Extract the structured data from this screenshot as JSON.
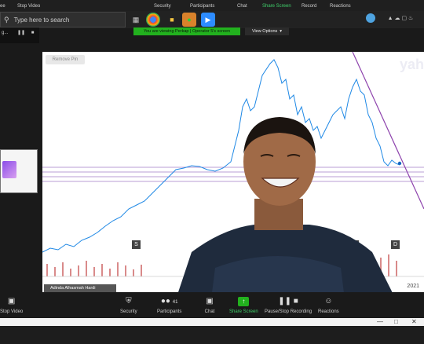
{
  "top_bar": {
    "items": [
      {
        "label": "ee"
      },
      {
        "label": "Stop Video"
      },
      {
        "label": "Security"
      },
      {
        "label": "Participants"
      },
      {
        "label": "Chat"
      },
      {
        "label": "Share Screen"
      },
      {
        "label": "Record"
      },
      {
        "label": "Reactions"
      }
    ]
  },
  "taskbar": {
    "search_placeholder": "Type here to search"
  },
  "share": {
    "banner": "You are viewing Perkap | Operator 5's screen",
    "view_options": "View Options",
    "remove_pin": "Remove Pin",
    "watermark": "yah",
    "marker_s": "S",
    "marker_d1": "D",
    "marker_d2": "D",
    "year": "2021",
    "name_tag": "Adinda Alhasmah Hardi"
  },
  "mini_panel": {
    "label": "g..."
  },
  "bottom_bar": {
    "items": [
      {
        "label": "Stop Video"
      },
      {
        "label": "Security"
      },
      {
        "label": "Participants"
      },
      {
        "label": "Chat"
      },
      {
        "label": "Share Screen"
      },
      {
        "label": "Pause/Stop Recording"
      },
      {
        "label": "Reactions"
      }
    ],
    "participants_count": "41"
  },
  "colors": {
    "accent_green": "#22b11e",
    "chart_line": "#1e88e5",
    "trend_line": "#8e44ad"
  }
}
